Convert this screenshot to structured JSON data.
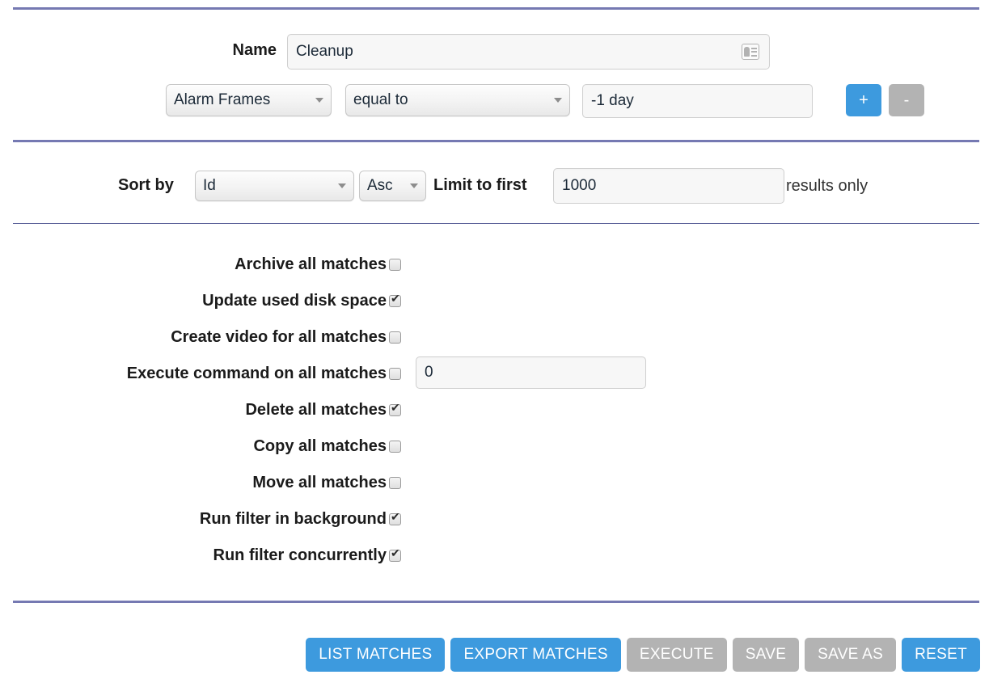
{
  "name_row": {
    "label": "Name",
    "value": "Cleanup",
    "placeholder": "",
    "autofill_icon": "contact-card-icon"
  },
  "filter_row": {
    "field": "Alarm Frames",
    "operator": "equal to",
    "value": "-1 day",
    "value_placeholder": "",
    "add_label": "+",
    "remove_label": "-"
  },
  "sort_row": {
    "sort_by_label": "Sort by",
    "sort_field": "Id",
    "sort_direction": "Asc",
    "limit_label": "Limit to first",
    "limit_value": "1000",
    "limit_placeholder": "",
    "results_label": "results only"
  },
  "options": [
    {
      "label": "Archive all matches",
      "checked": false
    },
    {
      "label": "Update used disk space",
      "checked": true
    },
    {
      "label": "Create video for all matches",
      "checked": false
    },
    {
      "label": "Execute command on all matches",
      "checked": false,
      "command_value": "0"
    },
    {
      "label": "Delete all matches",
      "checked": true
    },
    {
      "label": "Copy all matches",
      "checked": false
    },
    {
      "label": "Move all matches",
      "checked": false
    },
    {
      "label": "Run filter in background",
      "checked": true
    },
    {
      "label": "Run filter concurrently",
      "checked": true
    }
  ],
  "buttons": [
    {
      "label": "LIST MATCHES",
      "style": "blue"
    },
    {
      "label": "EXPORT MATCHES",
      "style": "blue"
    },
    {
      "label": "EXECUTE",
      "style": "gray"
    },
    {
      "label": "SAVE",
      "style": "gray"
    },
    {
      "label": "SAVE AS",
      "style": "gray"
    },
    {
      "label": "RESET",
      "style": "blue"
    }
  ],
  "colors": {
    "accent_blue": "#3d9ade",
    "disabled_gray": "#b3b3b3",
    "divider_purple": "#7579b2",
    "divider_slate": "#5e649b"
  }
}
